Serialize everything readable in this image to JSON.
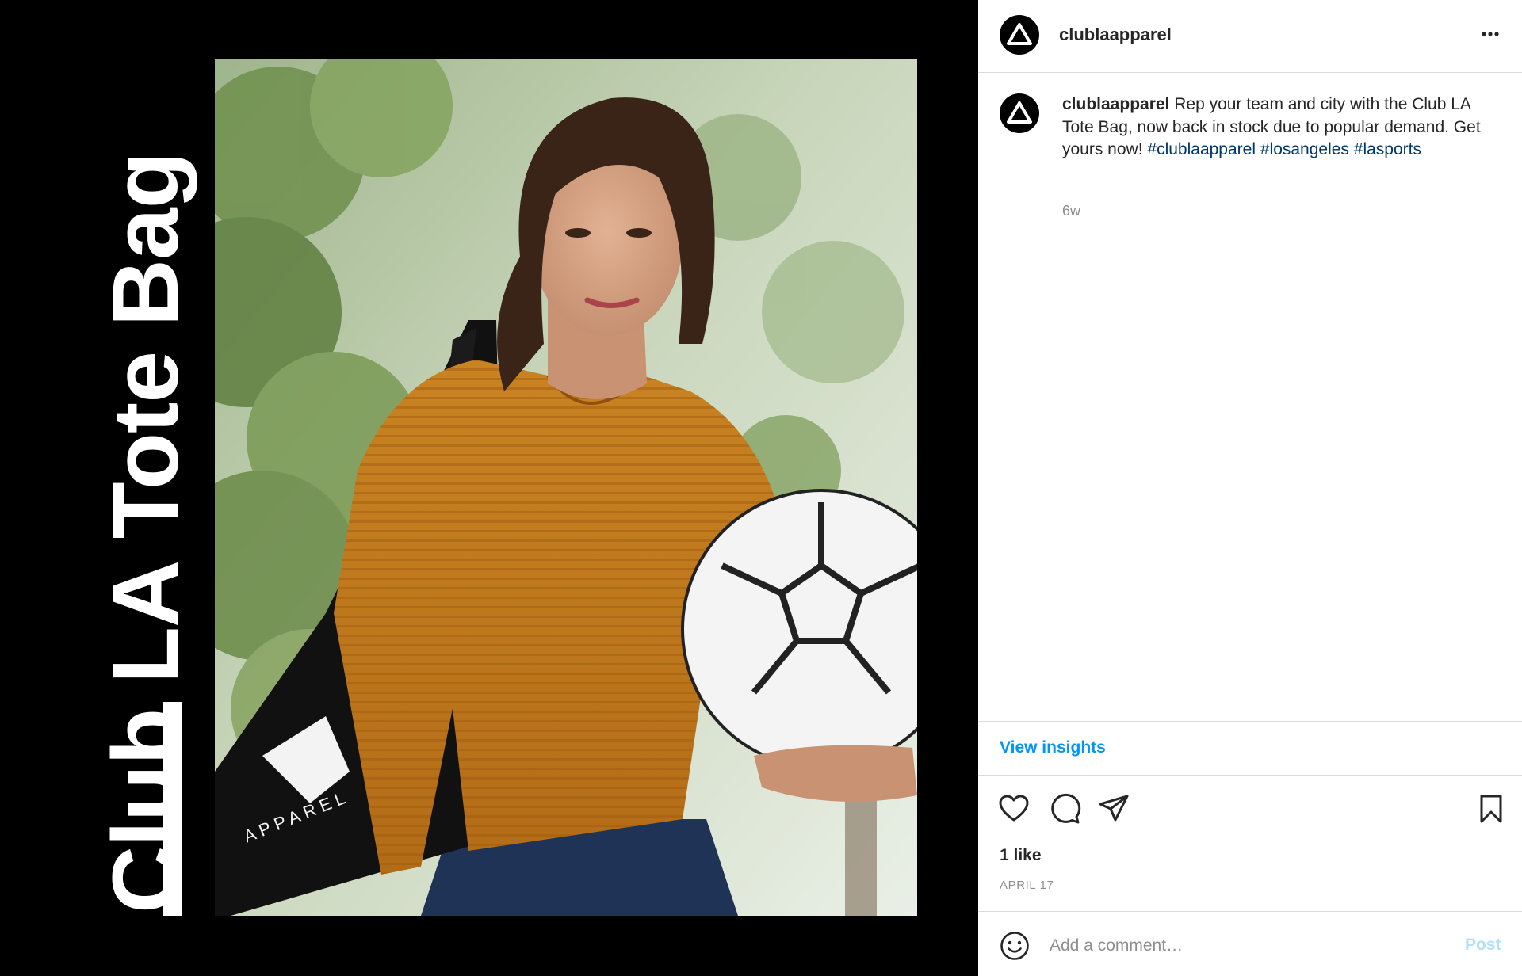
{
  "media": {
    "title": "Club LA Tote Bag",
    "bag_print": "APPAREL"
  },
  "header": {
    "username": "clublaapparel",
    "more_glyph": "more-horizontal-icon"
  },
  "caption": {
    "username": "clublaapparel",
    "text": "Rep your team and city with the Club LA Tote Bag, now back in stock due to popular demand. Get yours now!",
    "hashtags": [
      "#clublaapparel",
      "#losangeles",
      "#lasports"
    ],
    "age": "6w"
  },
  "insights": {
    "label": "View insights"
  },
  "actions": {
    "icons": [
      "heart-icon",
      "comment-icon",
      "share-icon",
      "bookmark-icon"
    ]
  },
  "engagement": {
    "likes": "1 like",
    "date": "APRIL 17"
  },
  "comment_box": {
    "placeholder": "Add a comment…",
    "post_label": "Post"
  },
  "colors": {
    "link": "#0095f6",
    "hashtag": "#00376b",
    "post_disabled": "#b2dffc",
    "muted": "#8e8e8e",
    "sweater": "#c57a1c"
  }
}
